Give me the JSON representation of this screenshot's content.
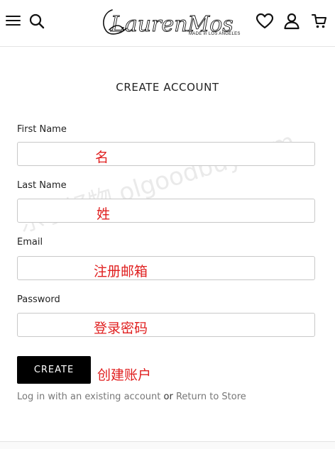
{
  "header": {
    "logo_text": "LaurenMoshi",
    "logo_tagline": "MADE in LOS ANGELES",
    "icons": [
      "hamburger-menu-icon",
      "search-icon",
      "heart-icon",
      "user-icon",
      "cart-icon"
    ]
  },
  "form": {
    "title": "CREATE ACCOUNT",
    "fields": [
      {
        "label": "First Name",
        "value": "",
        "annotation": "名"
      },
      {
        "label": "Last Name",
        "value": "",
        "annotation": "姓"
      },
      {
        "label": "Email",
        "value": "",
        "annotation": "注册邮箱"
      },
      {
        "label": "Password",
        "value": "",
        "annotation": "登录密码"
      }
    ],
    "submit_label": "CREATE",
    "submit_annotation": "创建账户"
  },
  "footer_links": {
    "login_text": "Log in with an existing account",
    "or_text": "or",
    "return_text": "Return to Store"
  },
  "watermark": "乐享好物 olgoodbuy.com",
  "colors": {
    "annotation": "#e02020",
    "button_bg": "#000000",
    "link": "#777777"
  }
}
